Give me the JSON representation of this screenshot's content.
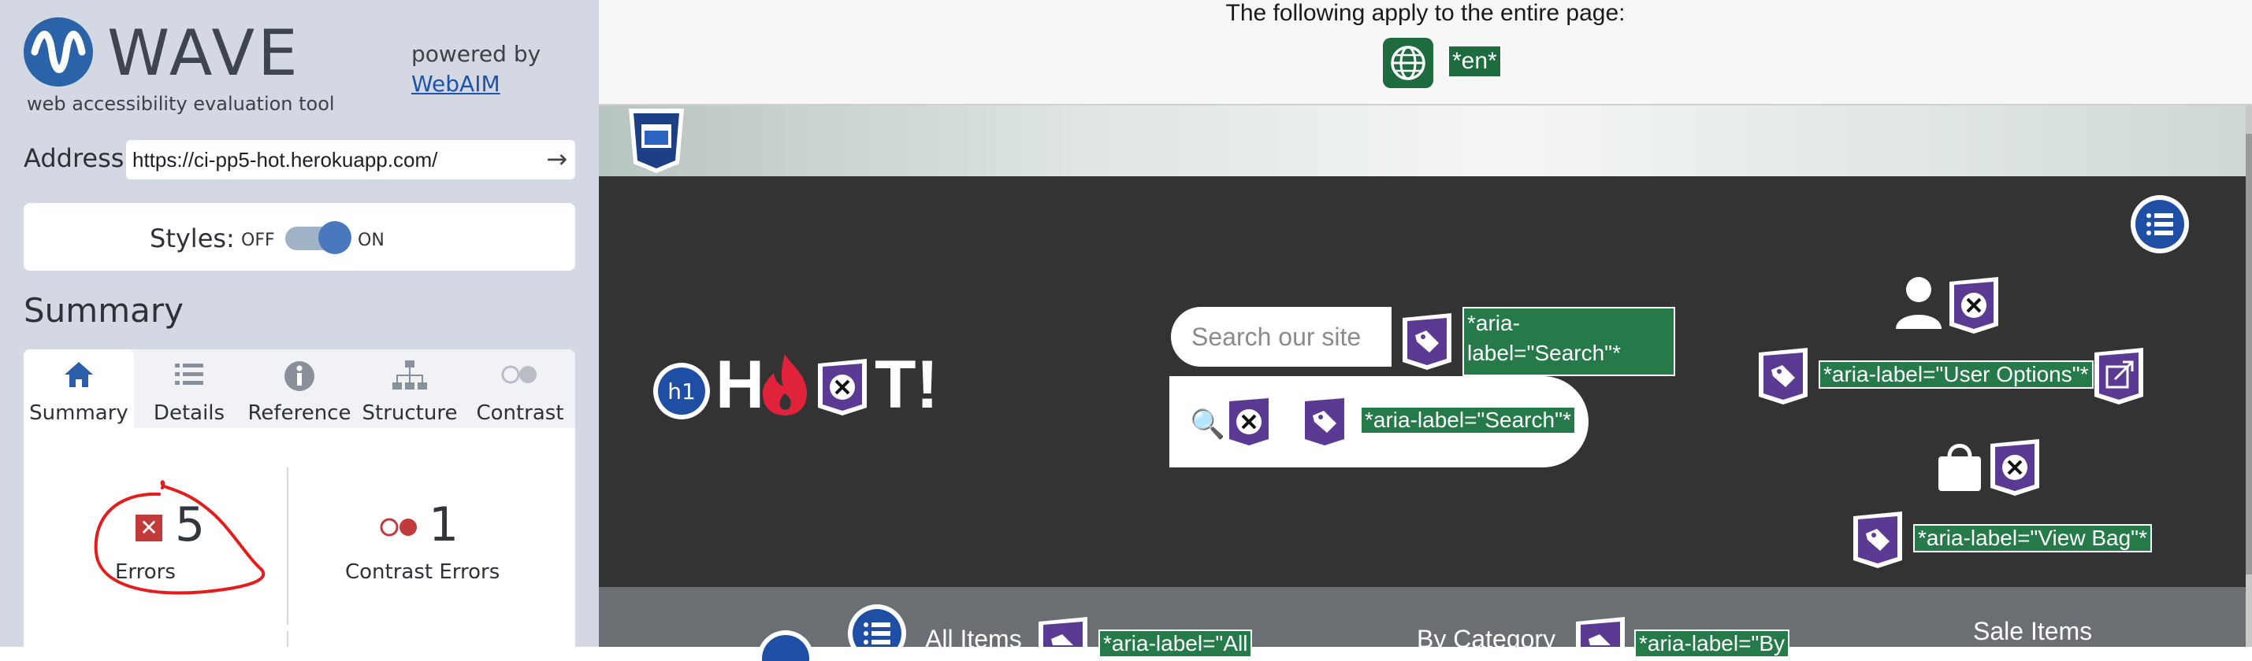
{
  "wave": {
    "logo_text": "WAVE",
    "tagline": "web accessibility evaluation tool",
    "powered_by": "powered by",
    "powered_link": "WebAIM",
    "address_label": "Address:",
    "address_value": "https://ci-pp5-hot.herokuapp.com/",
    "styles_label": "Styles:",
    "styles_off": "OFF",
    "styles_on": "ON",
    "summary_heading": "Summary",
    "tabs": [
      {
        "label": "Summary",
        "icon": "home-icon"
      },
      {
        "label": "Details",
        "icon": "list-icon"
      },
      {
        "label": "Reference",
        "icon": "info-icon"
      },
      {
        "label": "Structure",
        "icon": "sitemap-icon"
      },
      {
        "label": "Contrast",
        "icon": "contrast-icon"
      }
    ],
    "errors_count": "5",
    "errors_label": "Errors",
    "contrast_count": "1",
    "contrast_label": "Contrast Errors",
    "colors": {
      "accent": "#2b63a8",
      "error": "#c23a3a",
      "sidebar_bg": "#d3d8e2"
    }
  },
  "page": {
    "page_level_text": "The following apply to the entire page:",
    "lang_label": "*en*",
    "search_placeholder": "Search our site",
    "search_aria_1": "*aria-label=\"Search\"*",
    "search_aria_2": "*aria-label=\"Search\"*",
    "user_aria": "*aria-label=\"User Options\"*",
    "bag_aria": "*aria-label=\"View Bag\"*",
    "logo_h": "H",
    "logo_t": "T!",
    "h1_badge": "h1",
    "nav_all": "All Items",
    "nav_all_aria": "*aria-label=\"All",
    "nav_category": "By Category",
    "nav_category_aria": "*aria-label=\"By",
    "nav_sale": "Sale Items"
  }
}
